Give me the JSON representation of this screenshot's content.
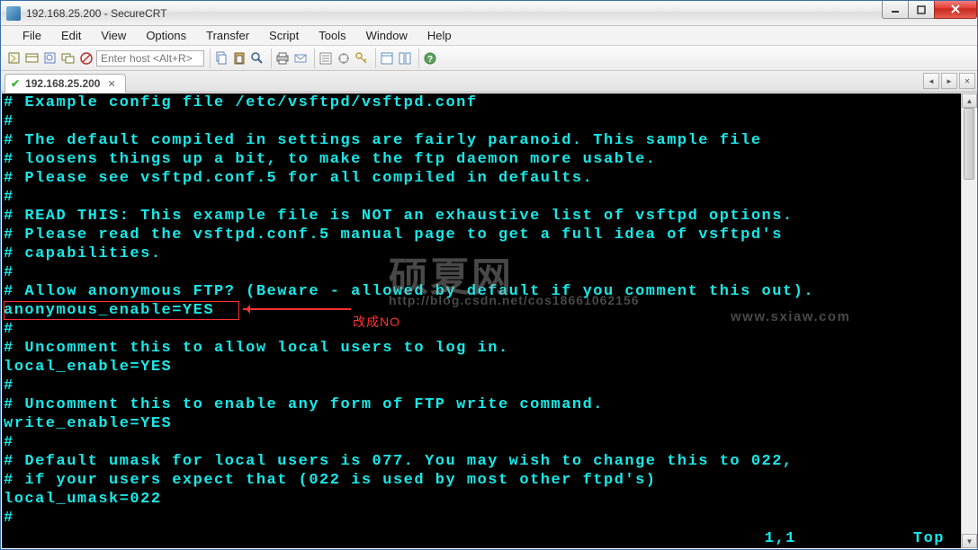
{
  "title": "192.168.25.200 - SecureCRT",
  "menu": [
    "File",
    "Edit",
    "View",
    "Options",
    "Transfer",
    "Script",
    "Tools",
    "Window",
    "Help"
  ],
  "host_placeholder": "Enter host <Alt+R>",
  "tab": {
    "label": "192.168.25.200"
  },
  "terminal_lines": [
    "# Example config file /etc/vsftpd/vsftpd.conf",
    "#",
    "# The default compiled in settings are fairly paranoid. This sample file",
    "# loosens things up a bit, to make the ftp daemon more usable.",
    "# Please see vsftpd.conf.5 for all compiled in defaults.",
    "#",
    "# READ THIS: This example file is NOT an exhaustive list of vsftpd options.",
    "# Please read the vsftpd.conf.5 manual page to get a full idea of vsftpd's",
    "# capabilities.",
    "#",
    "# Allow anonymous FTP? (Beware - allowed by default if you comment this out).",
    "anonymous_enable=YES",
    "#",
    "# Uncomment this to allow local users to log in.",
    "local_enable=YES",
    "#",
    "# Uncomment this to enable any form of FTP write command.",
    "write_enable=YES",
    "#",
    "# Default umask for local users is 077. You may wish to change this to 022,",
    "# if your users expect that (022 is used by most other ftpd's)",
    "local_umask=022",
    "#"
  ],
  "annotation": "改成NO",
  "status": {
    "pos": "1,1",
    "loc": "Top"
  },
  "watermark": {
    "big": "硕夏网",
    "url1": "http://blog.csdn.net/cos18661062156",
    "url2": "www.sxiaw.com"
  }
}
